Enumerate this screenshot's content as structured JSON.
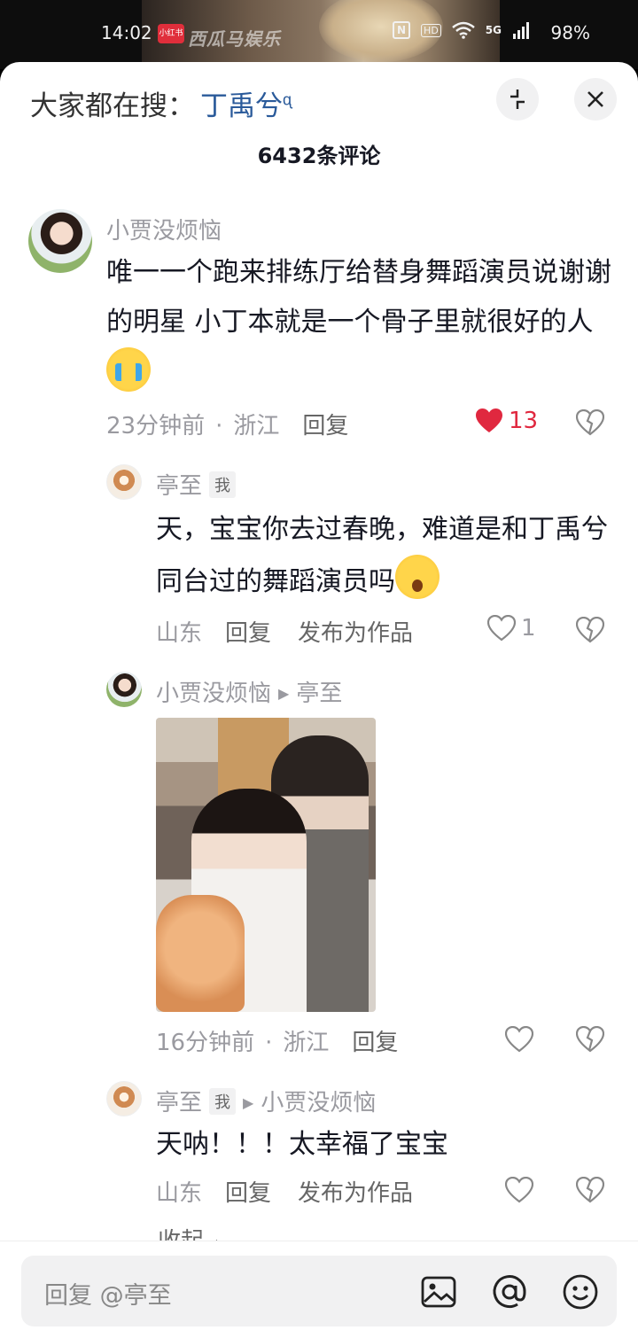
{
  "status_bar": {
    "time": "14:02",
    "app_badge": "小红书",
    "watermark": "西瓜马娱乐",
    "nfc": "N",
    "hd": "HD",
    "network": "5G",
    "battery": "98%"
  },
  "header": {
    "search_prefix": "大家都在搜：",
    "search_term": "丁禹兮",
    "comment_count": "6432条评论"
  },
  "comments": [
    {
      "user": "小贾没烦恼",
      "text": "唯一一个跑来排练厅给替身舞蹈演员说谢谢的明星  小丁本就是一个骨子里就很好的人",
      "emoji": "loudly-crying-face",
      "time": "23分钟前",
      "location": "浙江",
      "reply_label": "回复",
      "likes": "13",
      "liked": true
    },
    {
      "user": "亭至",
      "me_tag": "我",
      "text": "天，宝宝你去过春晚，难道是和丁禹兮同台过的舞蹈演员吗",
      "emoji": "astonished-face",
      "location": "山东",
      "reply_label": "回复",
      "publish_label": "发布为作品",
      "likes": "1"
    },
    {
      "user": "小贾没烦恼",
      "reply_to": "亭至",
      "image": "group-selfie-photo",
      "time": "16分钟前",
      "location": "浙江",
      "reply_label": "回复"
    },
    {
      "user": "亭至",
      "me_tag": "我",
      "reply_to": "小贾没烦恼",
      "text": "天呐！！！太幸福了宝宝",
      "location": "山东",
      "reply_label": "回复",
      "publish_label": "发布为作品"
    }
  ],
  "collapse_label": "收起",
  "reply_bar": {
    "placeholder": "回复 @亭至",
    "icons": [
      "image-icon",
      "at-icon",
      "emoji-icon"
    ]
  },
  "colors": {
    "like_red": "#e0283f",
    "link_blue": "#2a5a9a",
    "muted_gray": "#9a9aa0"
  }
}
